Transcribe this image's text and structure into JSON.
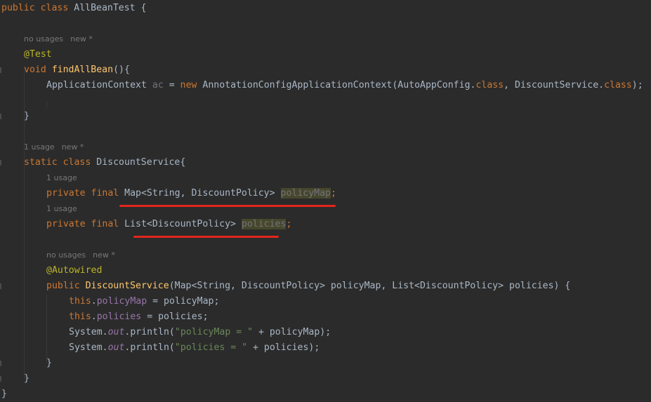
{
  "editor": {
    "l1": {
      "kw1": "public",
      "kw2": "class",
      "name": "AllBeanTest",
      "brace": "{"
    },
    "h1": {
      "usages": "no usages",
      "author": "new *"
    },
    "l2": {
      "ann": "@Test"
    },
    "l3": {
      "kw": "void",
      "fn": "findAllBean",
      "rest": "(){"
    },
    "l4": {
      "type": "ApplicationContext",
      "var": "ac",
      "eq": "=",
      "kw": "new",
      "call": "AnnotationConfigApplicationContext(AutoAppConfig.",
      "cls1": "class",
      "mid": ", DiscountService.",
      "cls2": "class",
      "end": ");"
    },
    "l5": {
      "brace": "}"
    },
    "h2": {
      "usages": "1 usage",
      "author": "new *"
    },
    "l6": {
      "kw1": "static",
      "kw2": "class",
      "name": "DiscountService{"
    },
    "h3": {
      "usages": "1 usage"
    },
    "l7": {
      "kw": "private final",
      "type": "Map<String, DiscountPolicy>",
      "field": "policyMap",
      "end": ";"
    },
    "h4": {
      "usages": "1 usage"
    },
    "l8": {
      "kw": "private final",
      "type": "List<DiscountPolicy>",
      "field": "policies",
      "end": ";"
    },
    "h5": {
      "usages": "no usages",
      "author": "new *"
    },
    "l9": {
      "ann": "@Autowired"
    },
    "l10": {
      "kw": "public",
      "fn": "DiscountService",
      "params": "(Map<String, DiscountPolicy> policyMap, List<DiscountPolicy> policies) {"
    },
    "l11": {
      "kw": "this",
      "dot": ".",
      "field": "policyMap",
      "rest": " = policyMap;"
    },
    "l12": {
      "kw": "this",
      "dot": ".",
      "field": "policies",
      "rest": " = policies;"
    },
    "l13": {
      "sys": "System.",
      "out": "out",
      "call": ".println(",
      "str": "\"policyMap = \"",
      "rest": " + policyMap);"
    },
    "l14": {
      "sys": "System.",
      "out": "out",
      "call": ".println(",
      "str": "\"policies = \"",
      "rest": " + policies);"
    },
    "l15": {
      "brace": "}"
    },
    "l16": {
      "brace": "}"
    },
    "l17": {
      "brace": "}"
    }
  },
  "colors": {
    "background": "#2b2b2b",
    "keyword": "#cc7832",
    "method": "#ffc66d",
    "annotation": "#bbb529",
    "field": "#9876aa",
    "string": "#6a8759",
    "underline": "#e3261c"
  }
}
